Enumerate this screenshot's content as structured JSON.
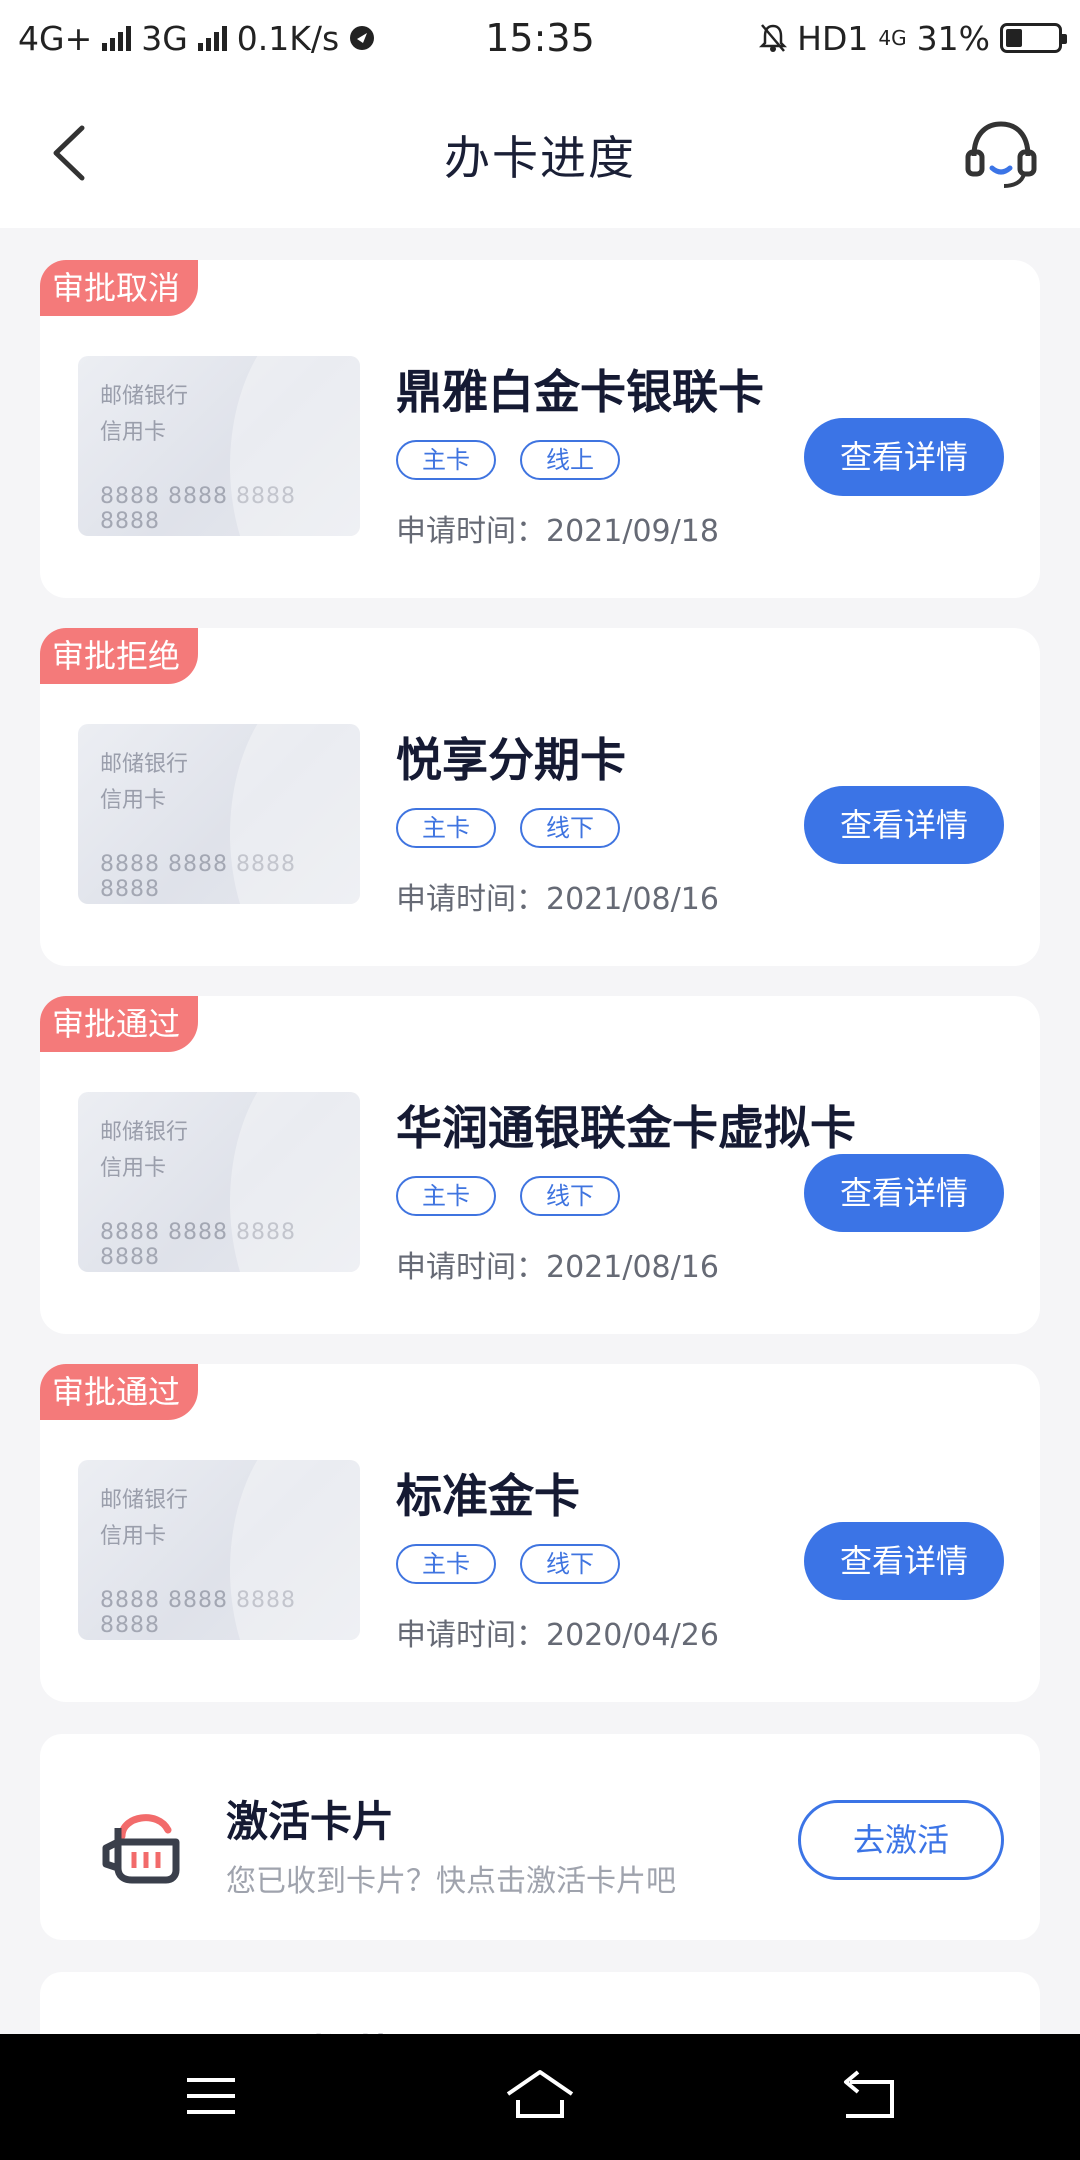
{
  "status_bar": {
    "left_text_1": "4G+",
    "left_text_2": "3G",
    "net_speed": "0.1K/s",
    "time": "15:35",
    "right_hd": "HD1",
    "right_net": "4G",
    "battery": "31%"
  },
  "header": {
    "title": "办卡进度"
  },
  "applications": [
    {
      "status": "审批取消",
      "bank": "邮储银行",
      "card_type": "信用卡",
      "card_number": "8888 8888 8888 8888",
      "name": "鼎雅白金卡银联卡",
      "tag_1": "主卡",
      "tag_2": "线上",
      "apply_time": "申请时间：2021/09/18",
      "button": "查看详情"
    },
    {
      "status": "审批拒绝",
      "bank": "邮储银行",
      "card_type": "信用卡",
      "card_number": "8888 8888 8888 8888",
      "name": "悦享分期卡",
      "tag_1": "主卡",
      "tag_2": "线下",
      "apply_time": "申请时间：2021/08/16",
      "button": "查看详情"
    },
    {
      "status": "审批通过",
      "bank": "邮储银行",
      "card_type": "信用卡",
      "card_number": "8888 8888 8888 8888",
      "name": "华润通银联金卡虚拟卡",
      "tag_1": "主卡",
      "tag_2": "线下",
      "apply_time": "申请时间：2021/08/16",
      "button": "查看详情"
    },
    {
      "status": "审批通过",
      "bank": "邮储银行",
      "card_type": "信用卡",
      "card_number": "8888 8888 8888 8888",
      "name": "标准金卡",
      "tag_1": "主卡",
      "tag_2": "线下",
      "apply_time": "申请时间：2020/04/26",
      "button": "查看详情"
    }
  ],
  "activate": {
    "title": "激活卡片",
    "description": "您已收到卡片？快点击激活卡片吧",
    "button": "去激活",
    "icon": "activate-card-icon"
  },
  "peek": {
    "text": "我要推荐"
  },
  "colors": {
    "primary": "#3b74e6",
    "status_tag": "#f47a7a"
  }
}
